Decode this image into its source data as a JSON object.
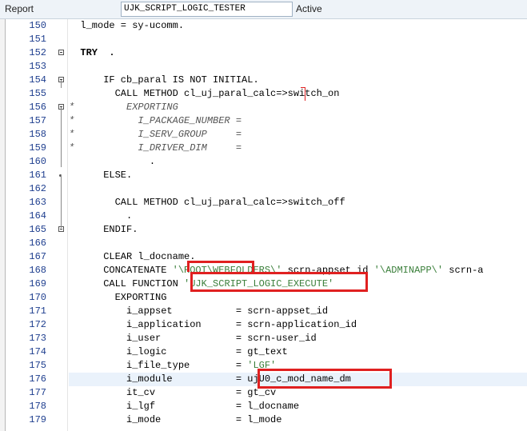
{
  "header": {
    "report_label": "Report",
    "report_name": "UJK_SCRIPT_LOGIC_TESTER",
    "status": "Active"
  },
  "editor": {
    "lines": [
      {
        "num": "150",
        "text": "  l_mode = sy-ucomm."
      },
      {
        "num": "151",
        "text": ""
      },
      {
        "num": "152",
        "text": "  TRY  ."
      },
      {
        "num": "153",
        "text": ""
      },
      {
        "num": "154",
        "text": "      IF cb_paral IS NOT INITIAL."
      },
      {
        "num": "155",
        "text": "        CALL METHOD cl_uj_paral_calc=>switch_on"
      },
      {
        "num": "156",
        "text": "*         EXPORTING"
      },
      {
        "num": "157",
        "text": "*           I_PACKAGE_NUMBER ="
      },
      {
        "num": "158",
        "text": "*           I_SERV_GROUP     ="
      },
      {
        "num": "159",
        "text": "*           I_DRIVER_DIM     ="
      },
      {
        "num": "160",
        "text": "              ."
      },
      {
        "num": "161",
        "text": "      ELSE."
      },
      {
        "num": "162",
        "text": ""
      },
      {
        "num": "163",
        "text": "        CALL METHOD cl_uj_paral_calc=>switch_off"
      },
      {
        "num": "164",
        "text": "          ."
      },
      {
        "num": "165",
        "text": "      ENDIF."
      },
      {
        "num": "166",
        "text": ""
      },
      {
        "num": "167",
        "text": "      CLEAR l_docname."
      },
      {
        "num": "168",
        "text": "      CONCATENATE '\\ROOT\\WEBFOLDERS\\' scrn-appset_id '\\ADMINAPP\\' scrn-a"
      },
      {
        "num": "169",
        "text": "      CALL FUNCTION 'UJK_SCRIPT_LOGIC_EXECUTE'"
      },
      {
        "num": "170",
        "text": "        EXPORTING"
      },
      {
        "num": "171",
        "text": "          i_appset           = scrn-appset_id"
      },
      {
        "num": "172",
        "text": "          i_application      = scrn-application_id"
      },
      {
        "num": "173",
        "text": "          i_user             = scrn-user_id"
      },
      {
        "num": "174",
        "text": "          i_logic            = gt_text"
      },
      {
        "num": "175",
        "text": "          i_file_type        = 'LGF'"
      },
      {
        "num": "176",
        "text": "          i_module           = ujU0_c_mod_name_dm"
      },
      {
        "num": "177",
        "text": "          it_cv              = gt_cv"
      },
      {
        "num": "178",
        "text": "          i_lgf              = l_docname"
      },
      {
        "num": "179",
        "text": "          i_mode             = l_mode"
      }
    ]
  },
  "colors": {
    "highlight_border": "#e02020",
    "line_number": "#1f3f8f",
    "string_literal": "#3a7f3a",
    "comment": "#555555"
  }
}
